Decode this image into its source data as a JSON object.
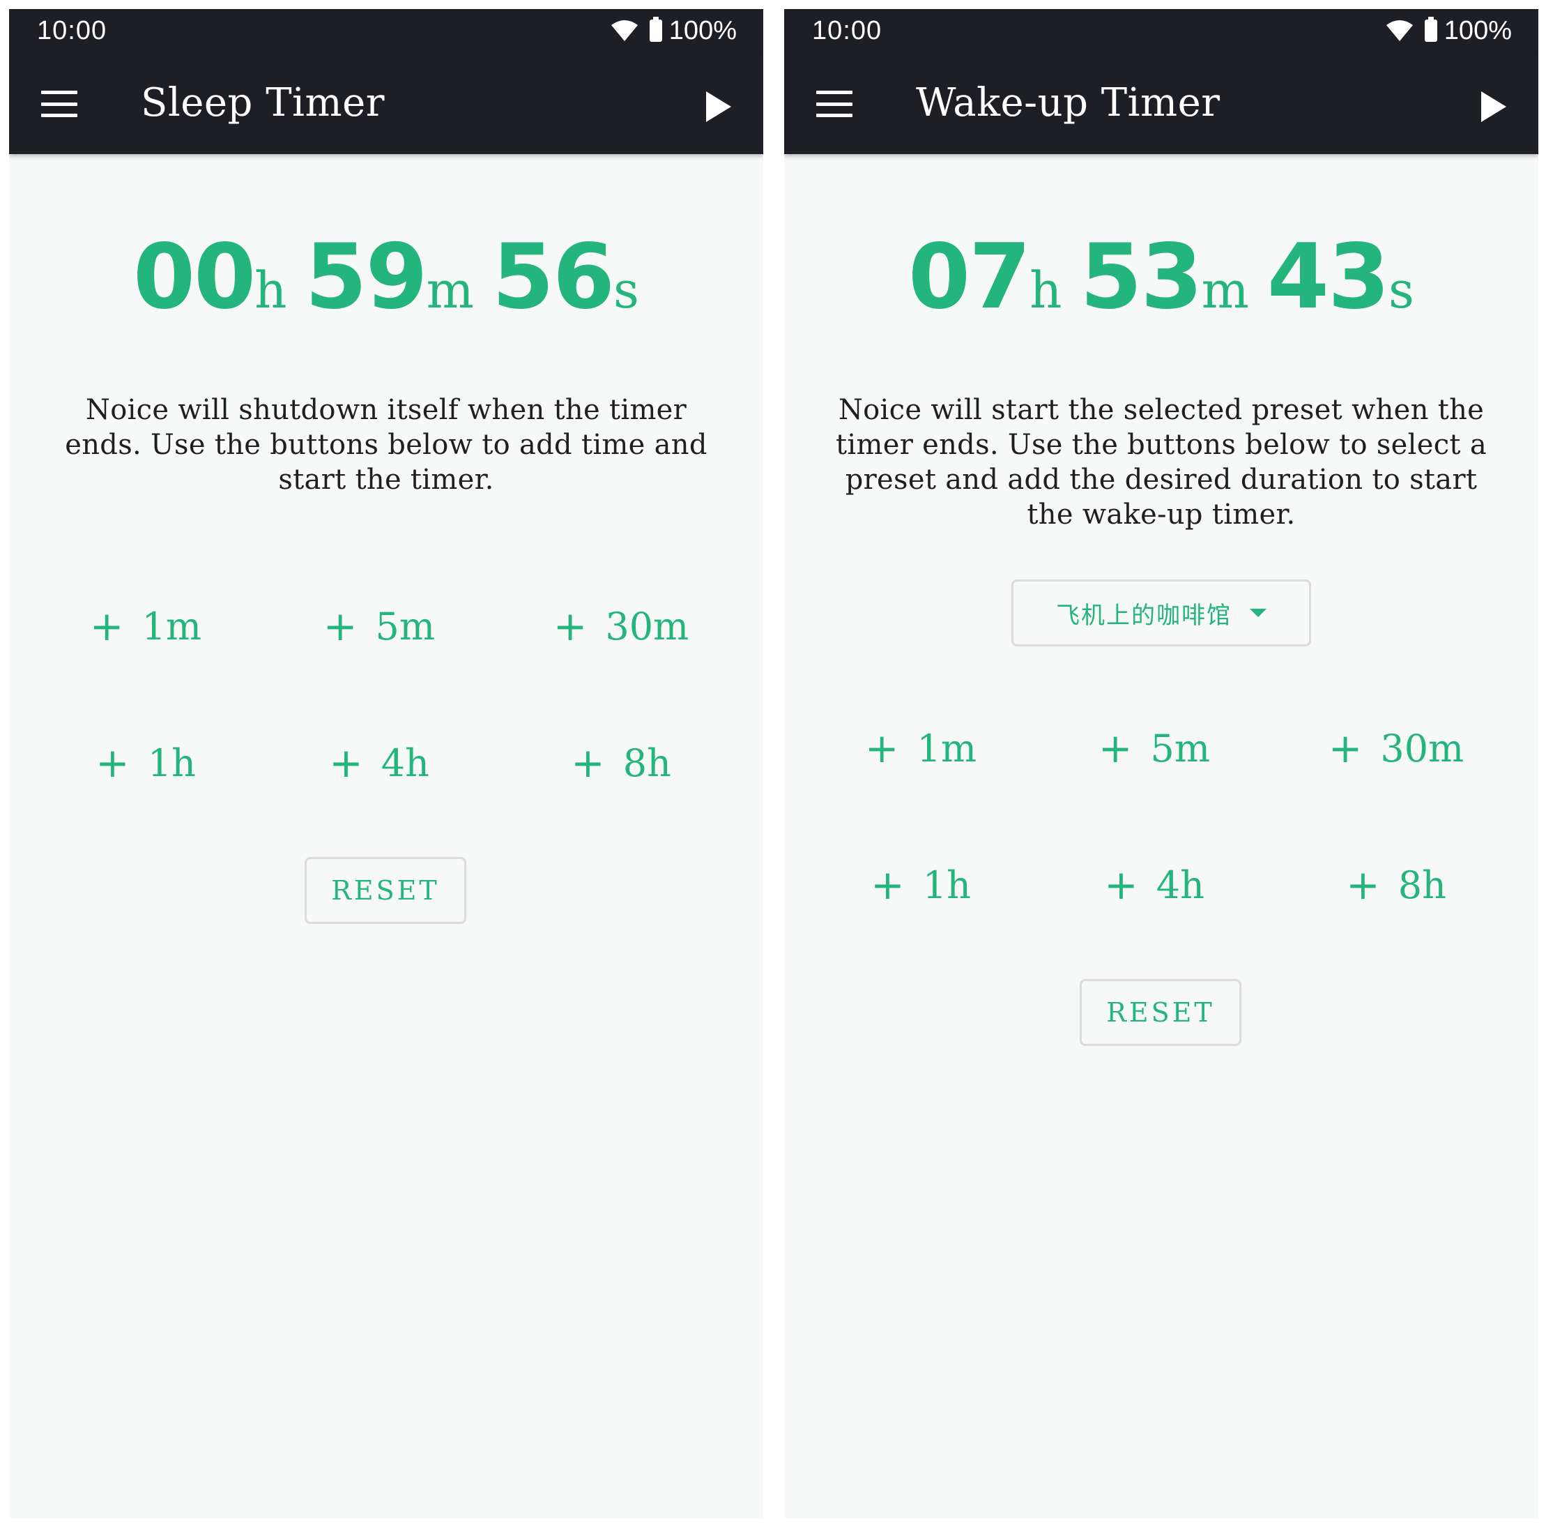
{
  "screens": [
    {
      "status": {
        "time": "10:00",
        "battery": "100%"
      },
      "title": "Sleep Timer",
      "timer": {
        "hours": "00",
        "h": "h",
        "minutes": "59",
        "m": "m",
        "seconds": "56",
        "s": "s"
      },
      "description": "Noice will shutdown itself when the timer ends. Use the buttons below to add time and start the timer.",
      "add_buttons": [
        "1m",
        "5m",
        "30m",
        "1h",
        "4h",
        "8h"
      ],
      "add_prefix": "+",
      "reset": "RESET"
    },
    {
      "status": {
        "time": "10:00",
        "battery": "100%"
      },
      "title": "Wake-up Timer",
      "timer": {
        "hours": "07",
        "h": "h",
        "minutes": "53",
        "m": "m",
        "seconds": "43",
        "s": "s"
      },
      "description": "Noice will start the selected preset when the timer ends. Use the buttons below to select a preset and add the desired duration to start the wake-up timer.",
      "preset": {
        "selected": "飞机上的咖啡馆"
      },
      "add_buttons": [
        "1m",
        "5m",
        "30m",
        "1h",
        "4h",
        "8h"
      ],
      "add_prefix": "+",
      "reset": "RESET"
    }
  ],
  "colors": {
    "accent": "#24b47e",
    "appbar": "#1e1f24",
    "background": "#f7f8f8",
    "text": "#1f1f1f"
  }
}
